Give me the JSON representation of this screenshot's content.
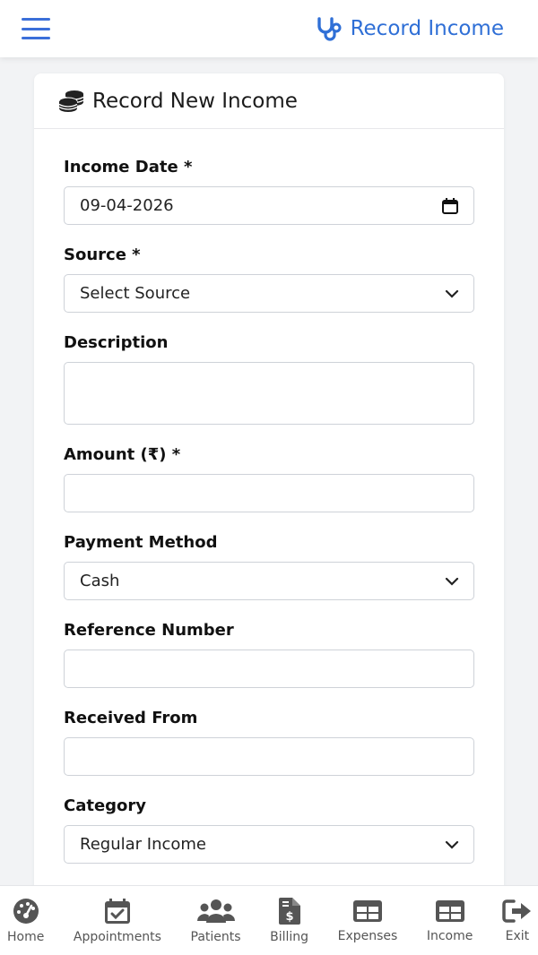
{
  "header": {
    "menu_icon": "hamburger-icon",
    "brand_icon": "stethoscope-icon",
    "title": "Record Income",
    "accent": "#2f6fd6"
  },
  "card": {
    "icon": "coins-icon",
    "title": "Record New Income"
  },
  "form": {
    "income_date": {
      "label": "Income Date *",
      "value": "09-04-2026",
      "icon": "calendar-icon"
    },
    "source": {
      "label": "Source *",
      "value": "Select Source"
    },
    "description": {
      "label": "Description",
      "value": ""
    },
    "amount": {
      "label": "Amount (₹) *",
      "value": ""
    },
    "payment_method": {
      "label": "Payment Method",
      "value": "Cash"
    },
    "reference_number": {
      "label": "Reference Number",
      "value": ""
    },
    "received_from": {
      "label": "Received From",
      "value": ""
    },
    "category": {
      "label": "Category",
      "value": "Regular Income"
    }
  },
  "bottom_nav": {
    "items": [
      {
        "label": "Home",
        "icon": "dashboard-gauge-icon"
      },
      {
        "label": "Appointments",
        "icon": "calendar-check-icon"
      },
      {
        "label": "Patients",
        "icon": "users-icon"
      },
      {
        "label": "Billing",
        "icon": "invoice-dollar-icon"
      },
      {
        "label": "Expenses",
        "icon": "table-icon"
      },
      {
        "label": "Income",
        "icon": "table-icon"
      },
      {
        "label": "Exit",
        "icon": "sign-out-icon"
      }
    ]
  }
}
